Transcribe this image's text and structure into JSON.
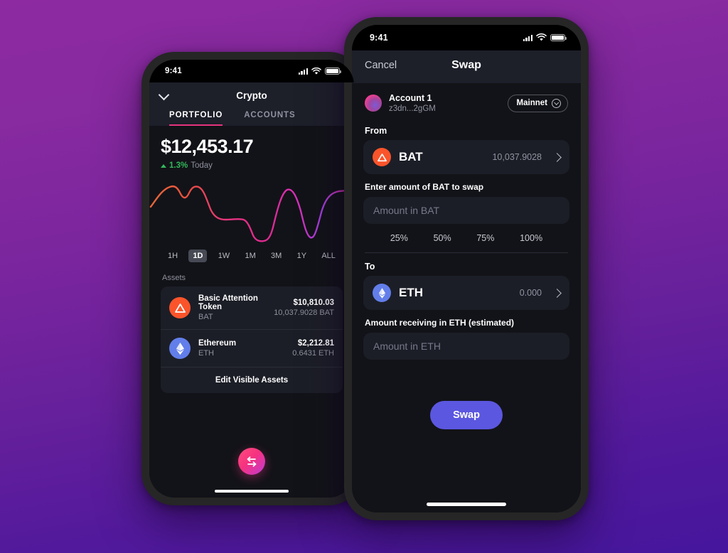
{
  "background": {
    "gradient_top": "#8d2aa2",
    "gradient_bottom": "#45169c"
  },
  "left_phone": {
    "status_bar": {
      "time": "9:41",
      "signal_icon": "cellular-signal-icon",
      "wifi_icon": "wifi-icon",
      "battery_icon": "battery-icon"
    },
    "header": {
      "collapse_icon": "chevron-down-icon",
      "title": "Crypto",
      "tabs": [
        {
          "label": "PORTFOLIO",
          "active": true
        },
        {
          "label": "ACCOUNTS",
          "active": false
        }
      ]
    },
    "portfolio": {
      "balance": "$12,453.17",
      "change_pct": "1.3%",
      "change_period": "Today",
      "change_direction_icon": "triangle-up-icon",
      "change_color": "#32b85a"
    },
    "ranges": [
      {
        "label": "1H",
        "active": false
      },
      {
        "label": "1D",
        "active": true
      },
      {
        "label": "1W",
        "active": false
      },
      {
        "label": "1M",
        "active": false
      },
      {
        "label": "3M",
        "active": false
      },
      {
        "label": "1Y",
        "active": false
      },
      {
        "label": "ALL",
        "active": false
      }
    ],
    "assets_label": "Assets",
    "assets": [
      {
        "icon": "bat-coin-icon",
        "icon_color": "#fb542b",
        "name": "Basic Attention Token",
        "symbol": "BAT",
        "fiat": "$10,810.03",
        "quantity": "10,037.9028 BAT"
      },
      {
        "icon": "eth-coin-icon",
        "icon_color": "#627eea",
        "name": "Ethereum",
        "symbol": "ETH",
        "fiat": "$2,212.81",
        "quantity": "0.6431 ETH"
      }
    ],
    "edit_assets_label": "Edit Visible Assets",
    "fab": {
      "icon": "swap-arrows-icon",
      "gradient_start": "#ff4d7d",
      "gradient_end": "#c03bd6"
    }
  },
  "right_phone": {
    "status_bar": {
      "time": "9:41",
      "signal_icon": "cellular-signal-icon",
      "wifi_icon": "wifi-icon",
      "battery_icon": "battery-icon"
    },
    "header": {
      "cancel_label": "Cancel",
      "title": "Swap"
    },
    "account": {
      "avatar_icon": "account-avatar",
      "name": "Account 1",
      "address": "z3dn...2gGM",
      "network_label": "Mainnet",
      "network_chevron_icon": "chevron-down-circle-icon"
    },
    "from": {
      "section_label": "From",
      "token_icon": "bat-coin-icon",
      "token_symbol": "BAT",
      "token_balance": "10,037.9028",
      "chevron_icon": "chevron-right-icon",
      "input_label": "Enter amount of BAT to swap",
      "input_value": "",
      "input_placeholder": "Amount in BAT",
      "percent_options": [
        "25%",
        "50%",
        "75%",
        "100%"
      ]
    },
    "to": {
      "section_label": "To",
      "token_icon": "eth-coin-icon",
      "token_symbol": "ETH",
      "token_balance": "0.000",
      "chevron_icon": "chevron-right-icon",
      "input_label": "Amount receiving in ETH (estimated)",
      "input_value": "",
      "input_placeholder": "Amount in ETH"
    },
    "submit": {
      "label": "Swap",
      "color": "#5b57e0"
    }
  },
  "chart_data": {
    "type": "line",
    "title": "",
    "xlabel": "",
    "ylabel": "",
    "grid": false,
    "legend": "none",
    "stroke_gradient": [
      "#e8683a",
      "#e6347f",
      "#d930bb",
      "#a33fe0"
    ],
    "x": [
      0,
      4,
      9,
      14,
      19,
      24,
      29,
      34,
      39,
      44,
      49,
      54,
      59,
      64,
      69,
      74,
      79,
      84,
      89,
      94,
      100
    ],
    "y": [
      52,
      66,
      74,
      76,
      70,
      62,
      70,
      76,
      74,
      58,
      40,
      34,
      33,
      33,
      24,
      10,
      12,
      34,
      62,
      76,
      66,
      20,
      56,
      74,
      74
    ]
  }
}
